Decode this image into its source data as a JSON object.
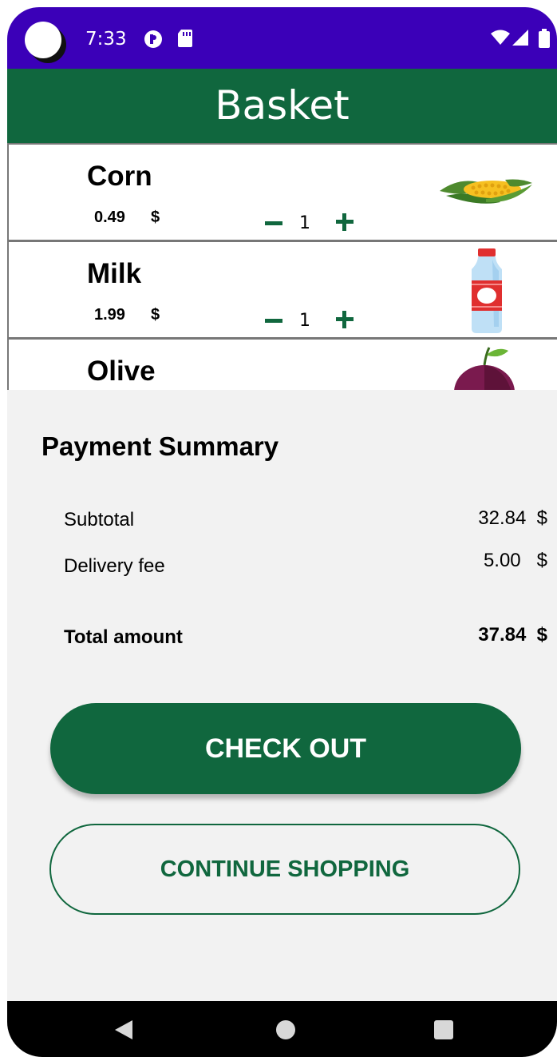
{
  "status_bar": {
    "time": "7:33",
    "icons": [
      "camera-cutout",
      "pocket-icon",
      "sd-card-icon",
      "wifi-icon",
      "signal-icon",
      "battery-icon"
    ]
  },
  "app_bar": {
    "title": "Basket"
  },
  "basket": {
    "items": [
      {
        "name": "Corn",
        "price": "0.49",
        "currency": "$",
        "quantity": "1",
        "icon": "corn-icon"
      },
      {
        "name": "Milk",
        "price": "1.99",
        "currency": "$",
        "quantity": "1",
        "icon": "milk-bottle-icon"
      },
      {
        "name": "Olive",
        "price": "",
        "currency": "",
        "quantity": "",
        "icon": "olive-icon"
      }
    ]
  },
  "summary": {
    "title": "Payment Summary",
    "subtotal_label": "Subtotal",
    "subtotal_value": "32.84  $",
    "delivery_label": "Delivery fee",
    "delivery_value": "5.00   $",
    "total_label": "Total amount",
    "total_value": "37.84  $"
  },
  "buttons": {
    "checkout": "CHECK OUT",
    "continue": "CONTINUE SHOPPING"
  },
  "colors": {
    "status_bar": "#3b00b8",
    "brand_green": "#10673e",
    "background": "#f2f2f2"
  }
}
